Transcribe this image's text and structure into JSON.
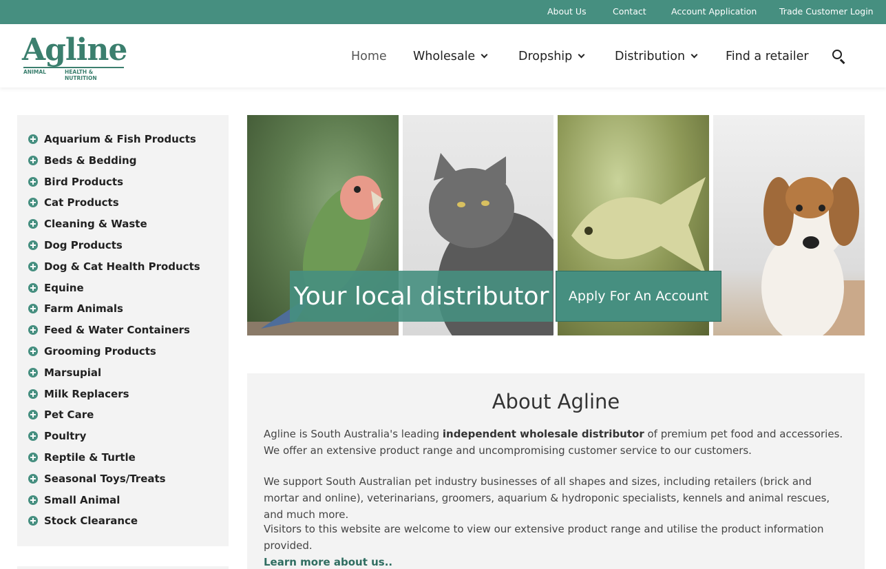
{
  "topbar": {
    "links": [
      "About Us",
      "Contact",
      "Account Application",
      "Trade Customer Login"
    ]
  },
  "logo": {
    "word": "Agline",
    "tag_left": "ANIMAL",
    "tag_right": "HEALTH & NUTRITION"
  },
  "nav": {
    "home": "Home",
    "wholesale": "Wholesale",
    "dropship": "Dropship",
    "distribution": "Distribution",
    "find_retailer": "Find a retailer",
    "search_icon": "search-icon"
  },
  "sidebar": {
    "items": [
      "Aquarium & Fish Products",
      "Beds & Bedding",
      "Bird Products",
      "Cat Products",
      "Cleaning & Waste",
      "Dog Products",
      "Dog & Cat Health Products",
      "Equine",
      "Farm Animals",
      "Feed & Water Containers",
      "Grooming Products",
      "Marsupial",
      "Milk Replacers",
      "Pet Care",
      "Poultry",
      "Reptile & Turtle",
      "Seasonal Toys/Treats",
      "Small Animal",
      "Stock Clearance"
    ]
  },
  "hero": {
    "tagline": "Your local distributor",
    "button": "Apply For An Account"
  },
  "about": {
    "title": "About Agline",
    "p1_before": "Agline is South Australia's leading ",
    "p1_strong": "independent wholesale distributor",
    "p1_after": " of premium pet food and accessories. We offer an extensive product range and uncompromising customer service to our customers.",
    "p2": "We support South Australian pet industry businesses of all shapes and sizes, including retailers (brick and mortar and online), veterinarians, groomers, aquarium & hydroponic specialists, kennels and animal rescues, and much more.",
    "p3": "Visitors to this website are welcome to view our extensive product range and utilise the product information provided.",
    "learn_more": "Learn more about us.."
  },
  "colors": {
    "brand_green": "#468f80",
    "sidebar_bg": "#f3f3f3"
  }
}
